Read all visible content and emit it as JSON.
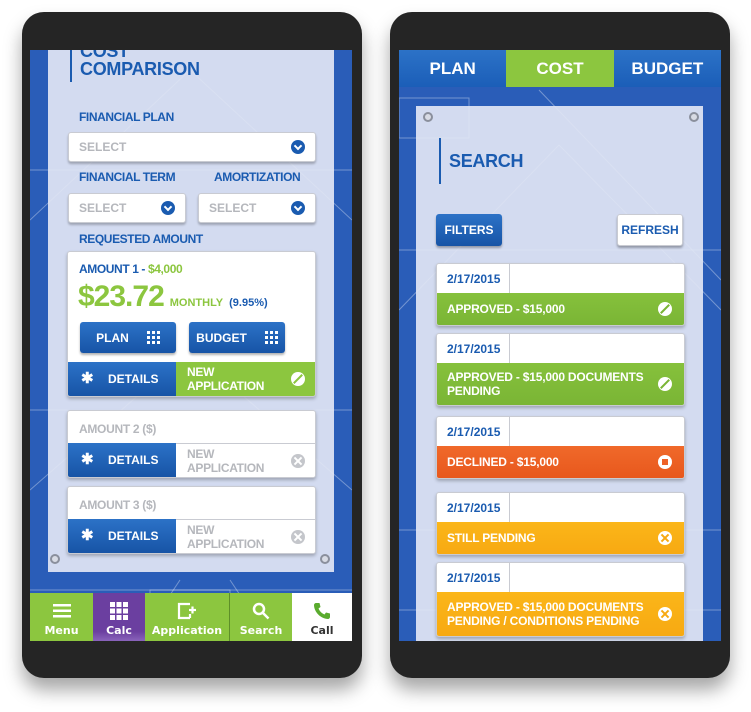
{
  "left_screen": {
    "title_line1": "COST",
    "title_line2": "COMPARISON",
    "financial_plan": {
      "label": "FINANCIAL PLAN",
      "value": "SELECT"
    },
    "financial_term": {
      "label": "FINANCIAL TERM",
      "value": "SELECT"
    },
    "amortization": {
      "label": "AMORTIZATION",
      "value": "SELECT"
    },
    "requested_amount_label": "REQUESTED AMOUNT",
    "amounts": [
      {
        "label": "AMOUNT 1 - ",
        "amount": "$4,000",
        "monthly_payment": "$23.72",
        "monthly_label": "MONTHLY",
        "rate": "(9.95%)",
        "plan_button": "PLAN",
        "budget_button": "BUDGET",
        "details_button": "DETAILS",
        "new_application_button": "NEW APPLICATION"
      },
      {
        "label": "AMOUNT 2 ($)",
        "details_button": "DETAILS",
        "new_application_button": "NEW APPLICATION"
      },
      {
        "label": "AMOUNT 3 ($)",
        "details_button": "DETAILS",
        "new_application_button": "NEW APPLICATION"
      }
    ],
    "bottom_nav": [
      {
        "label": "Menu",
        "icon": "menu-icon",
        "color": "#8cc63f"
      },
      {
        "label": "Calc",
        "icon": "calculator-grid-icon",
        "color": "#6b3fa0"
      },
      {
        "label": "Application",
        "icon": "application-add-icon",
        "color": "#8cc63f"
      },
      {
        "label": "Search",
        "icon": "search-icon",
        "color": "#8cc63f"
      },
      {
        "label": "Call",
        "icon": "phone-icon",
        "color": "#ffffff"
      }
    ]
  },
  "right_screen": {
    "tabs": [
      {
        "label": "PLAN",
        "active": false
      },
      {
        "label": "COST",
        "active": true
      },
      {
        "label": "BUDGET",
        "active": false
      }
    ],
    "title": "SEARCH",
    "filters_button": "FILTERS",
    "refresh_button": "REFRESH",
    "records": [
      {
        "date": "2/17/2015",
        "status_line1": "APPROVED - $15,000",
        "status_line2": "",
        "status": "approved",
        "icon": "approved-slash-icon"
      },
      {
        "date": "2/17/2015",
        "status_line1": "APPROVED - $15,000 DOCUMENTS",
        "status_line2": "PENDING",
        "status": "approved",
        "icon": "approved-slash-icon"
      },
      {
        "date": "2/17/2015",
        "status_line1": "DECLINED - $15,000",
        "status_line2": "",
        "status": "declined",
        "icon": "stop-icon"
      },
      {
        "date": "2/17/2015",
        "status_line1": "STILL PENDING",
        "status_line2": "",
        "status": "pending",
        "icon": "pending-x-icon"
      },
      {
        "date": "2/17/2015",
        "status_line1": "APPROVED - $15,000 DOCUMENTS",
        "status_line2": "PENDING / CONDITIONS PENDING",
        "status": "pending",
        "icon": "pending-x-icon"
      }
    ]
  },
  "colors": {
    "brand_blue": "#1a5bb0",
    "green": "#8cc63f",
    "purple": "#6b3fa0",
    "declined_orange": "#ee6228",
    "pending_yellow": "#fbb619"
  }
}
